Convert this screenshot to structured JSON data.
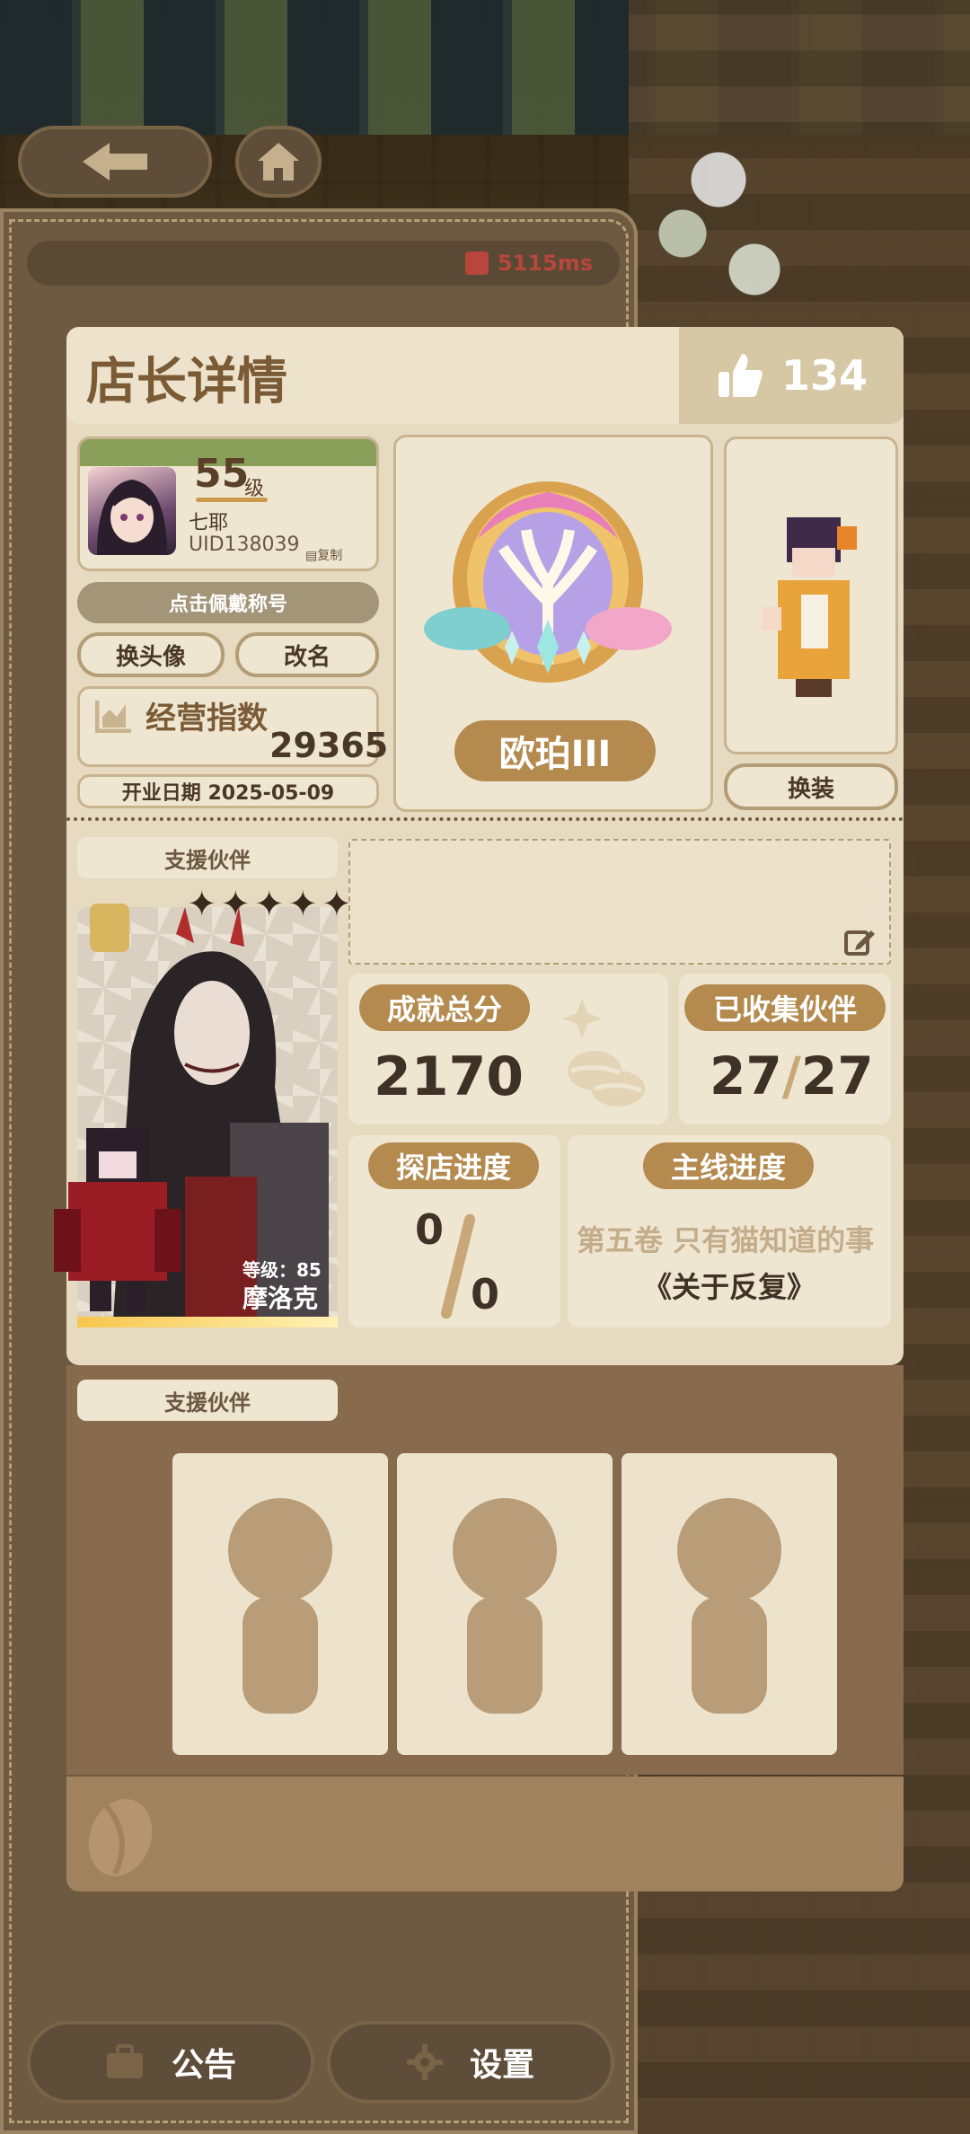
{
  "status": {
    "ping": "5115ms"
  },
  "header": {
    "title": "店长详情",
    "likes": "134"
  },
  "profile": {
    "level": "55",
    "level_suffix": "级",
    "name": "七耶",
    "uid": "UID138039",
    "copy_label": "复制",
    "title_button": "点击佩戴称号",
    "change_avatar": "换头像",
    "rename": "改名",
    "index_label": "经营指数",
    "index_value": "29365",
    "open_date": "开业日期 2025-05-09"
  },
  "medal": {
    "name": "欧珀III"
  },
  "outfit": {
    "button": "换装"
  },
  "partner": {
    "tag": "支援伙伴",
    "level": "等级：85",
    "name": "摩洛克",
    "stars": "✦✦✦✦✦"
  },
  "stats": {
    "achievement_label": "成就总分",
    "achievement_value": "2170",
    "collected_label": "已收集伙伴",
    "collected_a": "27",
    "collected_sep": "/",
    "collected_b": "27",
    "explore_label": "探店进度",
    "explore_a": "0",
    "explore_b": "0",
    "story_label": "主线进度",
    "story_chapter": "第五卷 只有猫知道的事",
    "story_title": "《关于反复》"
  },
  "support2": {
    "tag": "支援伙伴"
  },
  "bottom": {
    "notice": "公告",
    "settings": "设置"
  },
  "colors": {
    "accent": "#b48a4e",
    "panel": "#e6dac0",
    "frame": "#6e5a41"
  }
}
